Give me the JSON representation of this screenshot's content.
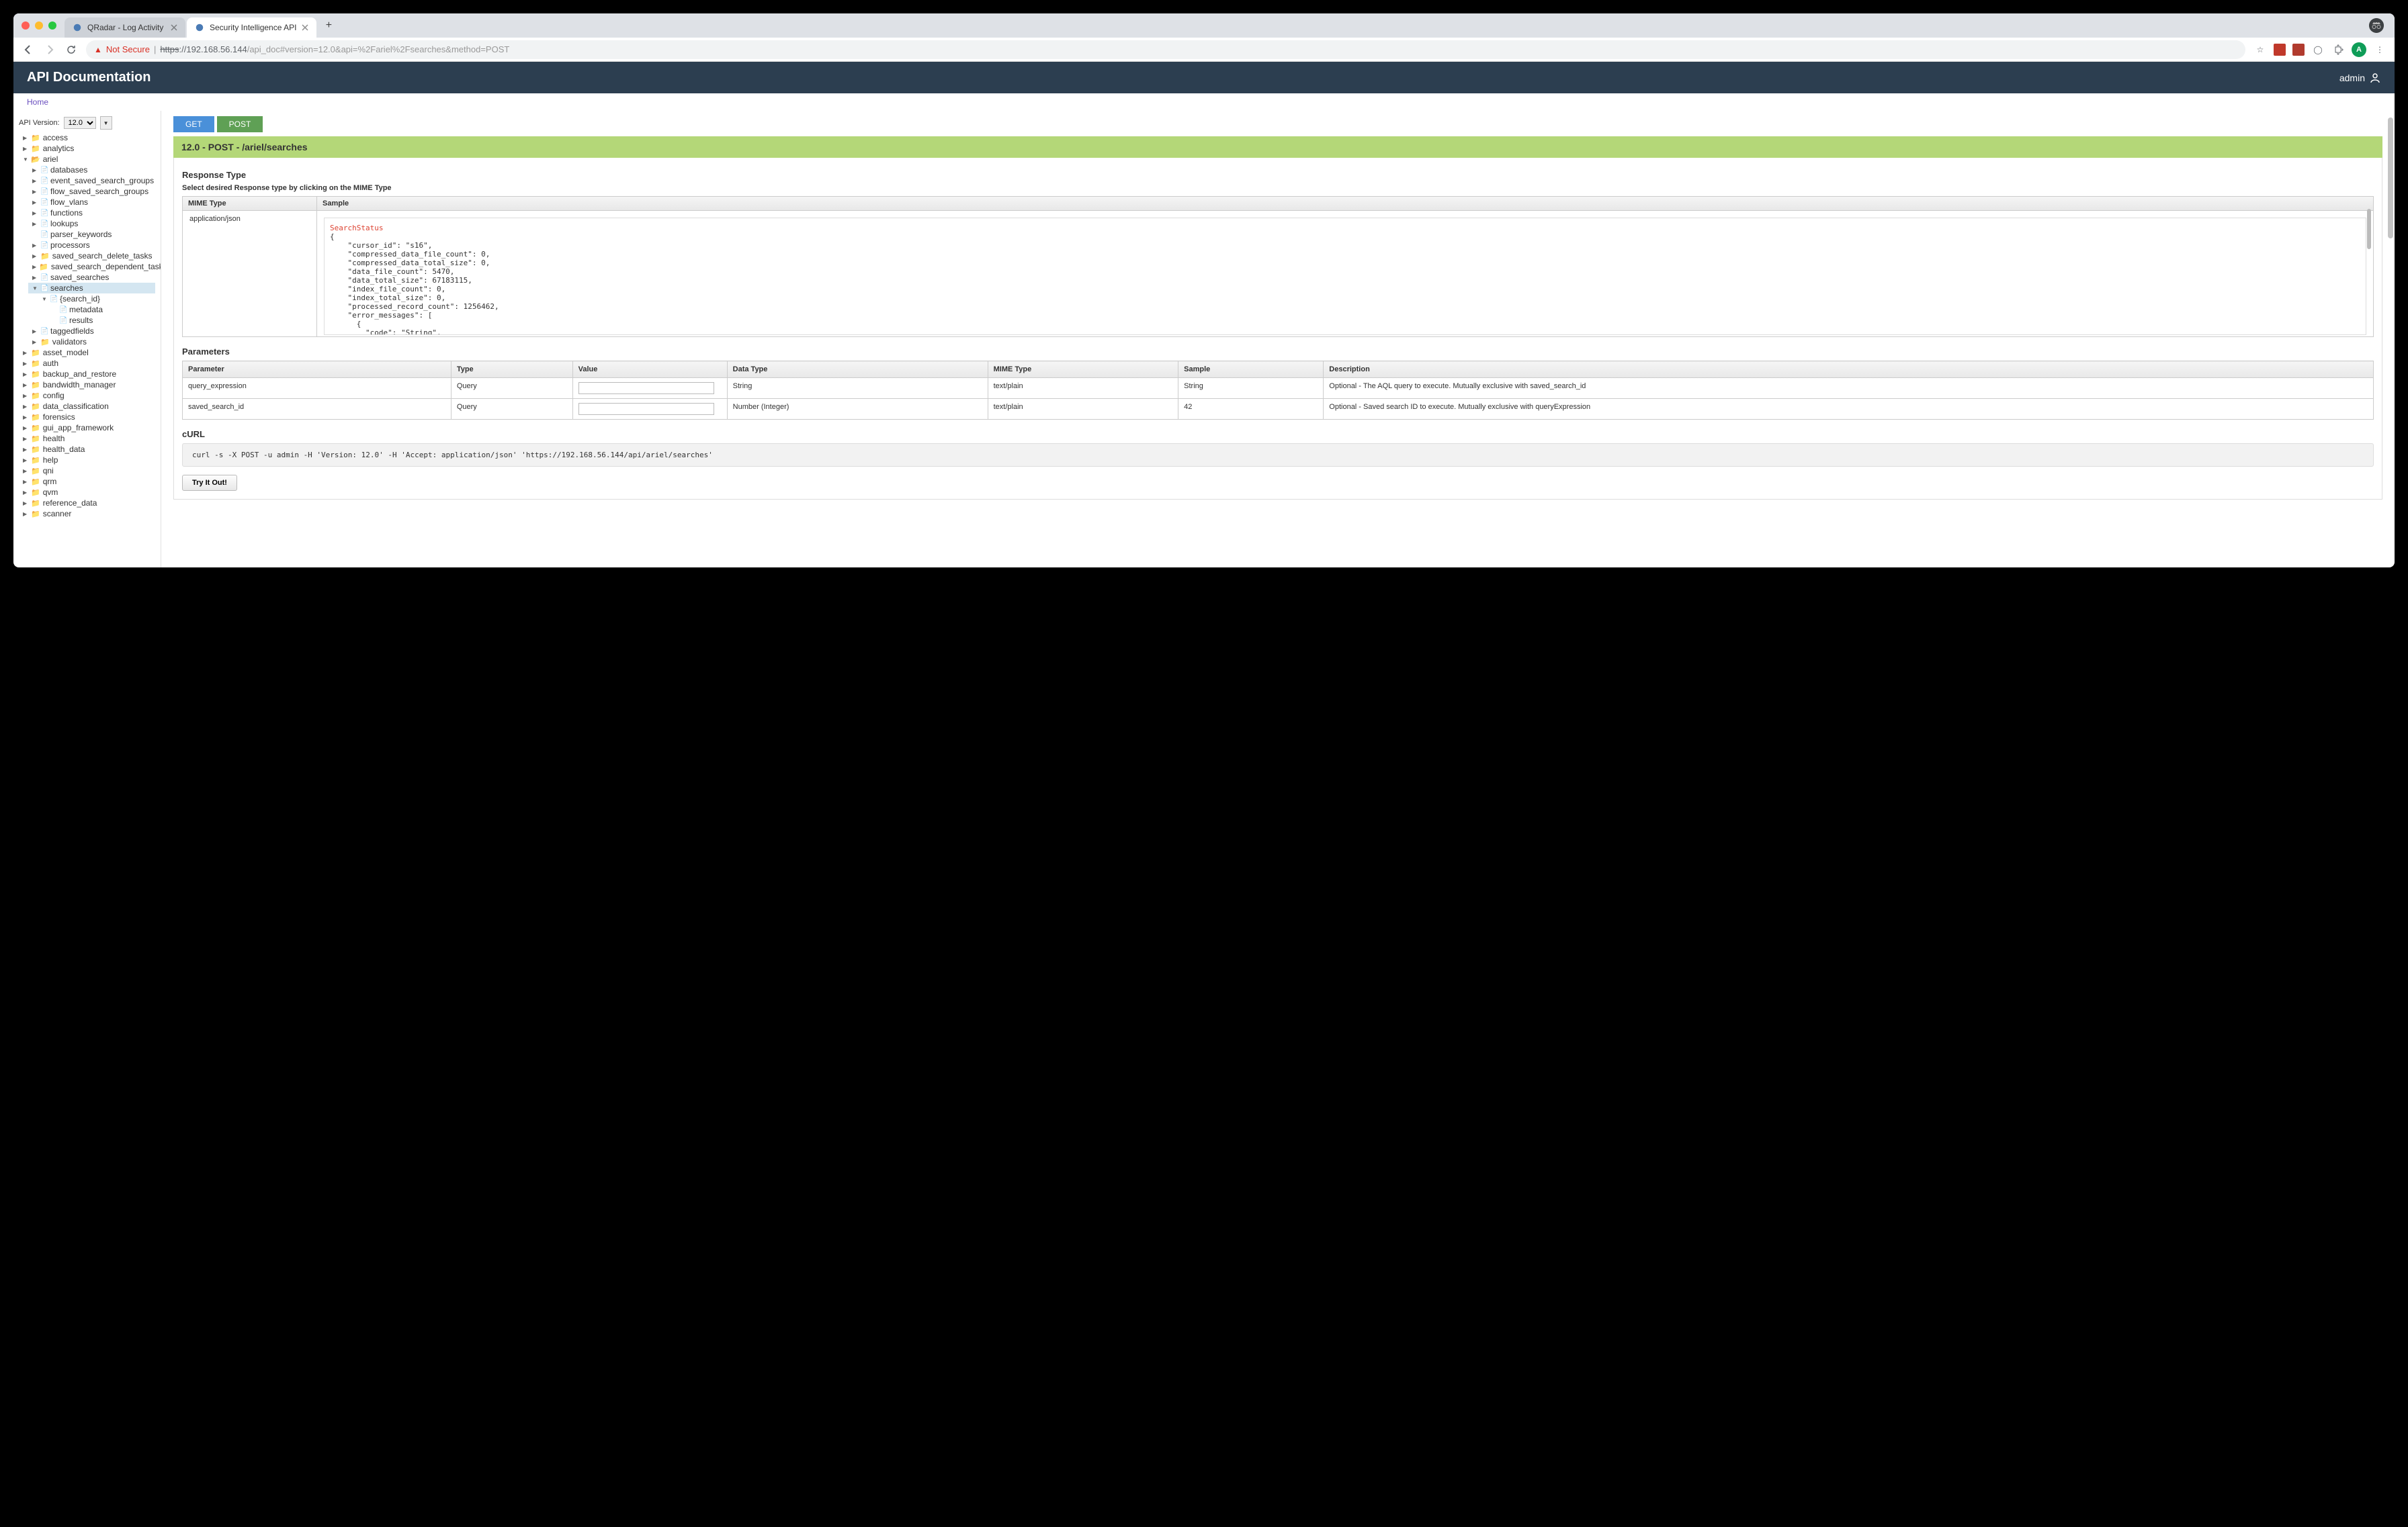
{
  "browser": {
    "tabs": [
      {
        "title": "QRadar - Log Activity",
        "active": false
      },
      {
        "title": "Security Intelligence API",
        "active": true
      }
    ],
    "not_secure_label": "Not Secure",
    "url_prefix": "https",
    "url_host": "://192.168.56.144",
    "url_path": "/api_doc#version=12.0&api=%2Fariel%2Fsearches&method=POST",
    "avatar_letter": "A"
  },
  "header": {
    "title": "API Documentation",
    "user": "admin"
  },
  "breadcrumb": {
    "home": "Home"
  },
  "sidebar": {
    "version_label": "API Version:",
    "version_value": "12.0",
    "tree": {
      "access": "access",
      "analytics": "analytics",
      "ariel": {
        "label": "ariel",
        "children": {
          "databases": "databases",
          "event_saved_search_groups": "event_saved_search_groups",
          "flow_saved_search_groups": "flow_saved_search_groups",
          "flow_vlans": "flow_vlans",
          "functions": "functions",
          "lookups": "lookups",
          "parser_keywords": "parser_keywords",
          "processors": "processors",
          "saved_search_delete_tasks": "saved_search_delete_tasks",
          "saved_search_dependent_tasks": "saved_search_dependent_tasks",
          "saved_searches": "saved_searches",
          "searches": {
            "label": "searches",
            "search_id": "{search_id}",
            "metadata": "metadata",
            "results": "results"
          },
          "taggedfields": "taggedfields",
          "validators": "validators"
        }
      },
      "asset_model": "asset_model",
      "auth": "auth",
      "backup_and_restore": "backup_and_restore",
      "bandwidth_manager": "bandwidth_manager",
      "config": "config",
      "data_classification": "data_classification",
      "forensics": "forensics",
      "gui_app_framework": "gui_app_framework",
      "health": "health",
      "health_data": "health_data",
      "help": "help",
      "qni": "qni",
      "qrm": "qrm",
      "qvm": "qvm",
      "reference_data": "reference_data",
      "scanner": "scanner"
    }
  },
  "main": {
    "methods": {
      "get": "GET",
      "post": "POST"
    },
    "endpoint_title": "12.0 - POST - /ariel/searches",
    "response_type_label": "Response Type",
    "response_type_sub": "Select desired Response type by clicking on the MIME Type",
    "mime_header": "MIME Type",
    "sample_header": "Sample",
    "mime_value": "application/json",
    "sample_title": "SearchStatus",
    "sample_body": "{\n    \"cursor_id\": \"s16\",\n    \"compressed_data_file_count\": 0,\n    \"compressed_data_total_size\": 0,\n    \"data_file_count\": 5470,\n    \"data_total_size\": 67183115,\n    \"index_file_count\": 0,\n    \"index_total_size\": 0,\n    \"processed_record_count\": 1256462,\n    \"error_messages\": [\n      {\n        \"code\": \"String\",\n        \"contexts\": [\n          \"String\"",
    "parameters_label": "Parameters",
    "params_headers": {
      "parameter": "Parameter",
      "type": "Type",
      "value": "Value",
      "data_type": "Data Type",
      "mime_type": "MIME Type",
      "sample": "Sample",
      "description": "Description"
    },
    "params_rows": [
      {
        "parameter": "query_expression",
        "type": "Query",
        "data_type": "String",
        "mime_type": "text/plain",
        "sample": "String",
        "description": "Optional - The AQL query to execute. Mutually exclusive with saved_search_id"
      },
      {
        "parameter": "saved_search_id",
        "type": "Query",
        "data_type": "Number (Integer)",
        "mime_type": "text/plain",
        "sample": "42",
        "description": "Optional - Saved search ID to execute. Mutually exclusive with queryExpression"
      }
    ],
    "curl_label": "cURL",
    "curl_command": "curl -s -X POST -u admin -H 'Version: 12.0' -H 'Accept: application/json' 'https://192.168.56.144/api/ariel/searches'",
    "try_button": "Try It Out!"
  }
}
